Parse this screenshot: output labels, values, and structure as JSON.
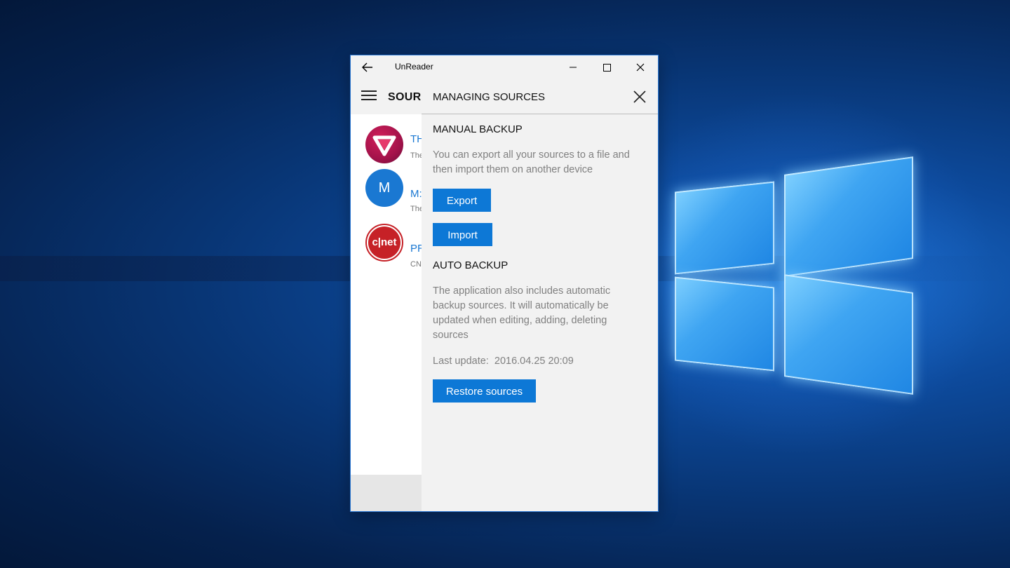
{
  "window": {
    "title": "UnReader",
    "back_icon": "arrow-left-icon",
    "minimize_glyph": "—",
    "close_glyph": "✕"
  },
  "header": {
    "menu_icon": "hamburger-icon",
    "title": "SOURC"
  },
  "sources": [
    {
      "avatar": "verge-logo",
      "title": "TH",
      "subtitle": "The"
    },
    {
      "avatar_letter": "M",
      "title": "M:",
      "subtitle": "The"
    },
    {
      "avatar": "cnet-logo",
      "avatar_text": "c|net",
      "title": "PR",
      "subtitle": "CN"
    }
  ],
  "panel": {
    "title": "MANAGING SOURCES",
    "close_icon": "close-icon",
    "manual_backup": {
      "title": "MANUAL BACKUP",
      "description": "You can export all your sources to a file and then import them on another device",
      "export_label": "Export",
      "import_label": "Import"
    },
    "auto_backup": {
      "title": "AUTO BACKUP",
      "description": "The application also includes automatic backup sources. It will automatically be updated when editing, adding, deleting sources",
      "last_update_label": "Last update:",
      "last_update_value": "2016.04.25 20:09",
      "restore_label": "Restore sources"
    }
  },
  "colors": {
    "accent": "#0d78d6",
    "link": "#1a78d2",
    "desktop": "#0a3f8c"
  }
}
